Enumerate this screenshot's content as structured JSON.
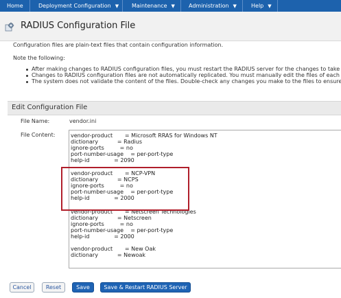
{
  "nav": {
    "home": "Home",
    "deployment": "Deployment Configuration",
    "maintenance": "Maintenance",
    "administration": "Administration",
    "help": "Help"
  },
  "page": {
    "title": "RADIUS Configuration File"
  },
  "intro": {
    "description": "Configuration files are plain-text files that contain configuration information.",
    "note_heading": "Note the following:",
    "bullets": [
      "After making changes to RADIUS configuration files, you must restart the RADIUS server for the changes to take eff",
      "Changes to RADIUS configuration files are not automatically replicated. You must manually edit the files of each RA",
      "The system does not validate the content of the files. Double-check any changes you make to the files to ensure tha"
    ]
  },
  "edit_section": {
    "heading": "Edit Configuration File",
    "file_name_label": "File Name:",
    "file_name_value": "vendor.ini",
    "file_content_label": "File Content:",
    "content_lines": [
      "vendor-product       = Microsoft RRAS for Windows NT",
      "dictionary           = Radius",
      "ignore-ports         = no",
      "port-number-usage    = per-port-type",
      "help-id              = 2090",
      "",
      "vendor-product       = NCP-VPN",
      "dictionary           = NCPS",
      "ignore-ports         = no",
      "port-number-usage    = per-port-type",
      "help-id              = 2000",
      "vendor-product       = Netscreen Technologies",
      "dictionary           = Netscreen",
      "ignore-ports         = no",
      "port-number-usage    = per-port-type",
      "help-id              = 2000",
      "",
      "vendor-product       = New Oak",
      "dictionary           = Newoak"
    ]
  },
  "buttons": {
    "cancel": "Cancel",
    "reset": "Reset",
    "save": "Save",
    "save_restart": "Save & Restart RADIUS Server"
  },
  "colors": {
    "nav_bg": "#1d62ad",
    "highlight_border": "#b01e2a",
    "primary_button": "#1e63b4"
  }
}
